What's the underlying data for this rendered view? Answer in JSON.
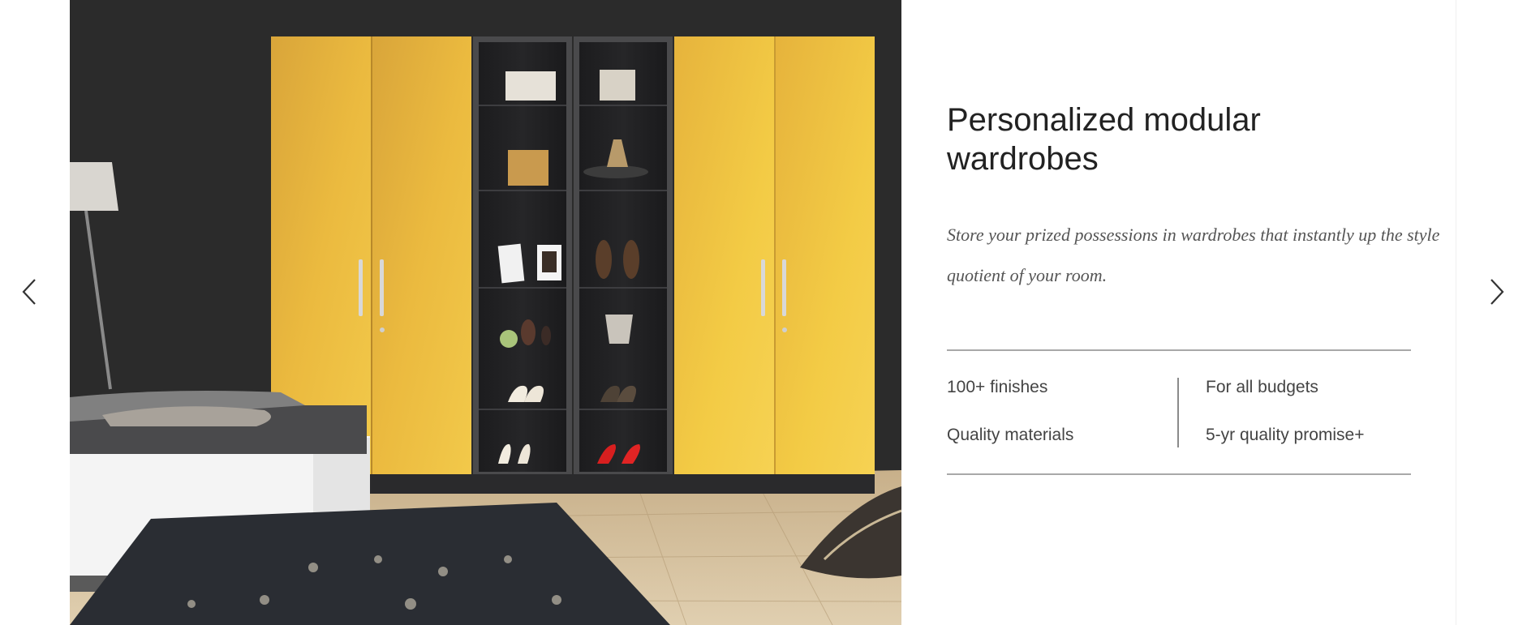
{
  "slide": {
    "title": "Personalized modular wardrobes",
    "description": "Store your prized possessions in wardrobes that instantly up the style quotient of your room.",
    "image_alt": "Yellow modular wardrobe with glass display shelves in a dark bedroom",
    "features": [
      "100+ finishes",
      "Quality materials",
      "For all budgets",
      "5-yr quality promise+"
    ]
  },
  "navigation": {
    "prev_icon": "chevron-left-icon",
    "next_icon": "chevron-right-icon"
  },
  "colors": {
    "wardrobe_yellow": "#e8b43a",
    "wall": "#2b2b2b",
    "title_text": "#222222",
    "body_text": "#555555",
    "divider": "#a8a8a8"
  }
}
